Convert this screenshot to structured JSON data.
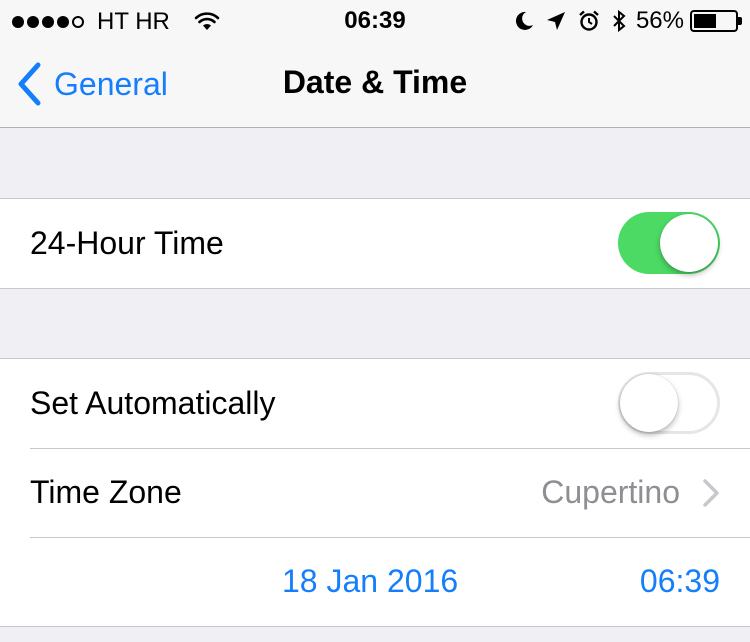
{
  "status_bar": {
    "carrier": "HT HR",
    "time": "06:39",
    "battery_percent": "56%",
    "battery_level": 0.56,
    "icons": [
      "wifi-icon",
      "moon-icon",
      "location-arrow-icon",
      "alarm-clock-icon",
      "bluetooth-icon",
      "battery-icon"
    ]
  },
  "nav": {
    "back_label": "General",
    "title": "Date & Time"
  },
  "settings": {
    "hour24": {
      "label": "24-Hour Time",
      "enabled": true
    },
    "set_automatically": {
      "label": "Set Automatically",
      "enabled": false
    },
    "time_zone": {
      "label": "Time Zone",
      "value": "Cupertino"
    },
    "date": "18 Jan 2016",
    "time": "06:39"
  },
  "colors": {
    "accent": "#157efb",
    "toggle_on": "#4cd964",
    "detail_text": "#8e8e93",
    "background": "#efeff4"
  }
}
